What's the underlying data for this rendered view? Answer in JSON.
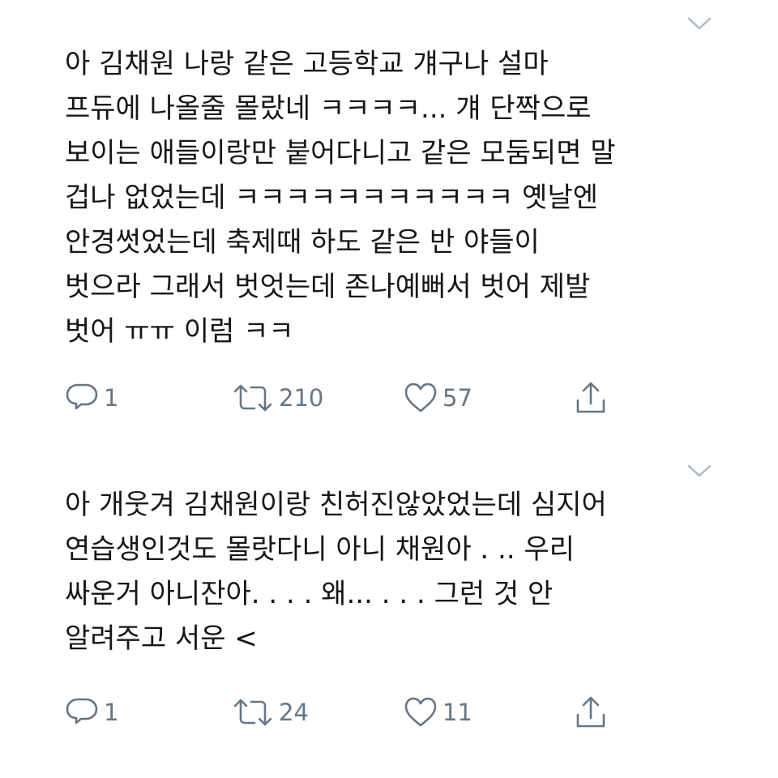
{
  "tweets": [
    {
      "text_lines": [
        "아 김채원 나랑 같은 고등학교 걔구나 설마",
        "프듀에 나올줄 몰랐네 ㅋㅋㅋㅋ... 걔 단짝으로",
        "보이는 애들이랑만 붙어다니고 같은 모둠되면 말",
        "겁나 없었는데 ㅋㅋㅋㅋㅋㅋㅋㅋㅋㅋㅋ 옛날엔",
        "안경썻었는데 축제때 하도 같은 반 야들이",
        "벗으라 그래서 벗엇는데 존나예뻐서 벗어 제발",
        "벗어 ㅠㅠ 이럼 ㅋㅋ"
      ],
      "replies": "1",
      "retweets": "210",
      "likes": "57"
    },
    {
      "text_lines": [
        "아 개웃겨 김채원이랑 친허진않았었는데 심지어",
        "연습생인것도 몰랏다니 아니 채원아 . ..  우리",
        "싸운거 아니잔아. . . .  왜... . . .  그런 것 안",
        "알려주고 서운 <"
      ],
      "replies": "1",
      "retweets": "24",
      "likes": "11"
    }
  ],
  "icons": {
    "caret": "chevron-down-icon",
    "reply": "reply-icon",
    "retweet": "retweet-icon",
    "like": "heart-icon",
    "share": "share-icon"
  },
  "colors": {
    "text": "#14171a",
    "icon": "#657786",
    "caret": "#aab8c2",
    "background": "#ffffff"
  }
}
